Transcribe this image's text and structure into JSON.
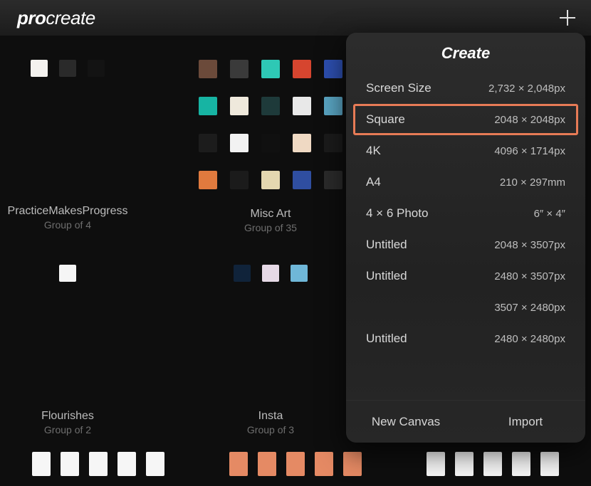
{
  "app": {
    "logo_bold": "pro",
    "logo_rest": "create"
  },
  "panel": {
    "title": "Create",
    "presets": [
      {
        "name": "Screen Size",
        "dim": "2,732 × 2,048px",
        "highlight": false
      },
      {
        "name": "Square",
        "dim": "2048 × 2048px",
        "highlight": true
      },
      {
        "name": "4K",
        "dim": "4096 × 1714px",
        "highlight": false
      },
      {
        "name": "A4",
        "dim": "210 × 297mm",
        "highlight": false
      },
      {
        "name": "4 × 6 Photo",
        "dim": "6″ × 4″",
        "highlight": false
      },
      {
        "name": "Untitled",
        "dim": "2048 × 3507px",
        "highlight": false
      },
      {
        "name": "Untitled",
        "dim": "2480 × 3507px",
        "highlight": false
      },
      {
        "name": "",
        "dim": "3507 × 2480px",
        "highlight": false
      },
      {
        "name": "Untitled",
        "dim": "2480 × 2480px",
        "highlight": false
      }
    ],
    "new_canvas": "New Canvas",
    "import": "Import"
  },
  "stacks": [
    {
      "title": "PracticeMakesProgress",
      "sub": "Group of 4",
      "thumbs": [
        "#f4f2ef",
        "#2a2a2a",
        "#131313"
      ]
    },
    {
      "title": "Misc Art",
      "sub": "Group of 35",
      "thumbs": [
        "#6b4a3a",
        "#3a3a3a",
        "#2ec8b5",
        "#d6452f",
        "#2d4fb0",
        "#17b4a3",
        "#efe9dc",
        "#1e3a3a",
        "#e8e8e8",
        "#5aa6c4",
        "#1c1c1c",
        "#f2f2f2",
        "#101010",
        "#efd9c3",
        "#1b1b1b",
        "#e07a3e",
        "#1b1b1b",
        "#e4d7b0",
        "#2f4ea0",
        "#2b2b2b"
      ]
    },
    {
      "title": "Flourishes",
      "sub": "Group of 2",
      "thumbs": [
        "#f5f5f5"
      ]
    },
    {
      "title": "Insta",
      "sub": "Group of 3",
      "thumbs": [
        "#10233a",
        "#e6d9e6",
        "#6fb7d8"
      ]
    }
  ],
  "bottom_row": [
    [
      "#f6f6f6",
      "#f6f6f6",
      "#f6f6f6",
      "#f6f6f6",
      "#f6f6f6"
    ],
    [
      "#e58a64",
      "#e58a64",
      "#e58a64",
      "#e58a64",
      "#e58a64"
    ],
    [
      "#f6f6f6",
      "#f6f6f6",
      "#f6f6f6",
      "#f6f6f6",
      "#f6f6f6"
    ]
  ]
}
